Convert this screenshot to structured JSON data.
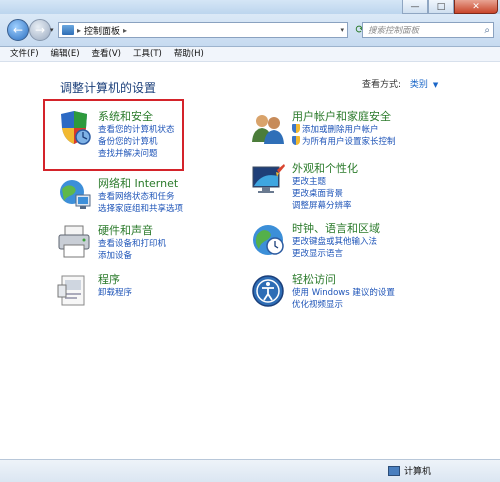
{
  "window": {
    "minimize": "—",
    "maximize": "□",
    "close": "✕"
  },
  "address": {
    "separator": "▸",
    "path": "控制面板",
    "dropdown": "▾",
    "history": "▾"
  },
  "search": {
    "placeholder": "搜索控制面板"
  },
  "menu": [
    "文件(F)",
    "编辑(E)",
    "查看(V)",
    "工具(T)",
    "帮助(H)"
  ],
  "content": {
    "heading": "调整计算机的设置",
    "view_by_label": "查看方式:",
    "view_by_value": "类别"
  },
  "categories": [
    {
      "icon": "system-security-icon",
      "title": "系统和安全",
      "links": [
        "查看您的计算机状态",
        "备份您的计算机",
        "查找并解决问题"
      ]
    },
    {
      "icon": "network-icon",
      "title": "网络和 Internet",
      "links": [
        "查看网络状态和任务",
        "选择家庭组和共享选项"
      ]
    },
    {
      "icon": "hardware-sound-icon",
      "title": "硬件和声音",
      "links": [
        "查看设备和打印机",
        "添加设备"
      ]
    },
    {
      "icon": "programs-icon",
      "title": "程序",
      "links": [
        "卸载程序"
      ]
    },
    {
      "icon": "user-accounts-icon",
      "title": "用户帐户和家庭安全",
      "links": [
        "添加或删除用户帐户",
        "为所有用户设置家长控制"
      ]
    },
    {
      "icon": "appearance-icon",
      "title": "外观和个性化",
      "links": [
        "更改主题",
        "更改桌面背景",
        "调整屏幕分辨率"
      ]
    },
    {
      "icon": "clock-region-icon",
      "title": "时钟、语言和区域",
      "links": [
        "更改键盘或其他输入法",
        "更改显示语言"
      ]
    },
    {
      "icon": "ease-of-access-icon",
      "title": "轻松访问",
      "links": [
        "使用 Windows 建议的设置",
        "优化视频显示"
      ]
    }
  ],
  "status": {
    "computer": "计算机"
  }
}
